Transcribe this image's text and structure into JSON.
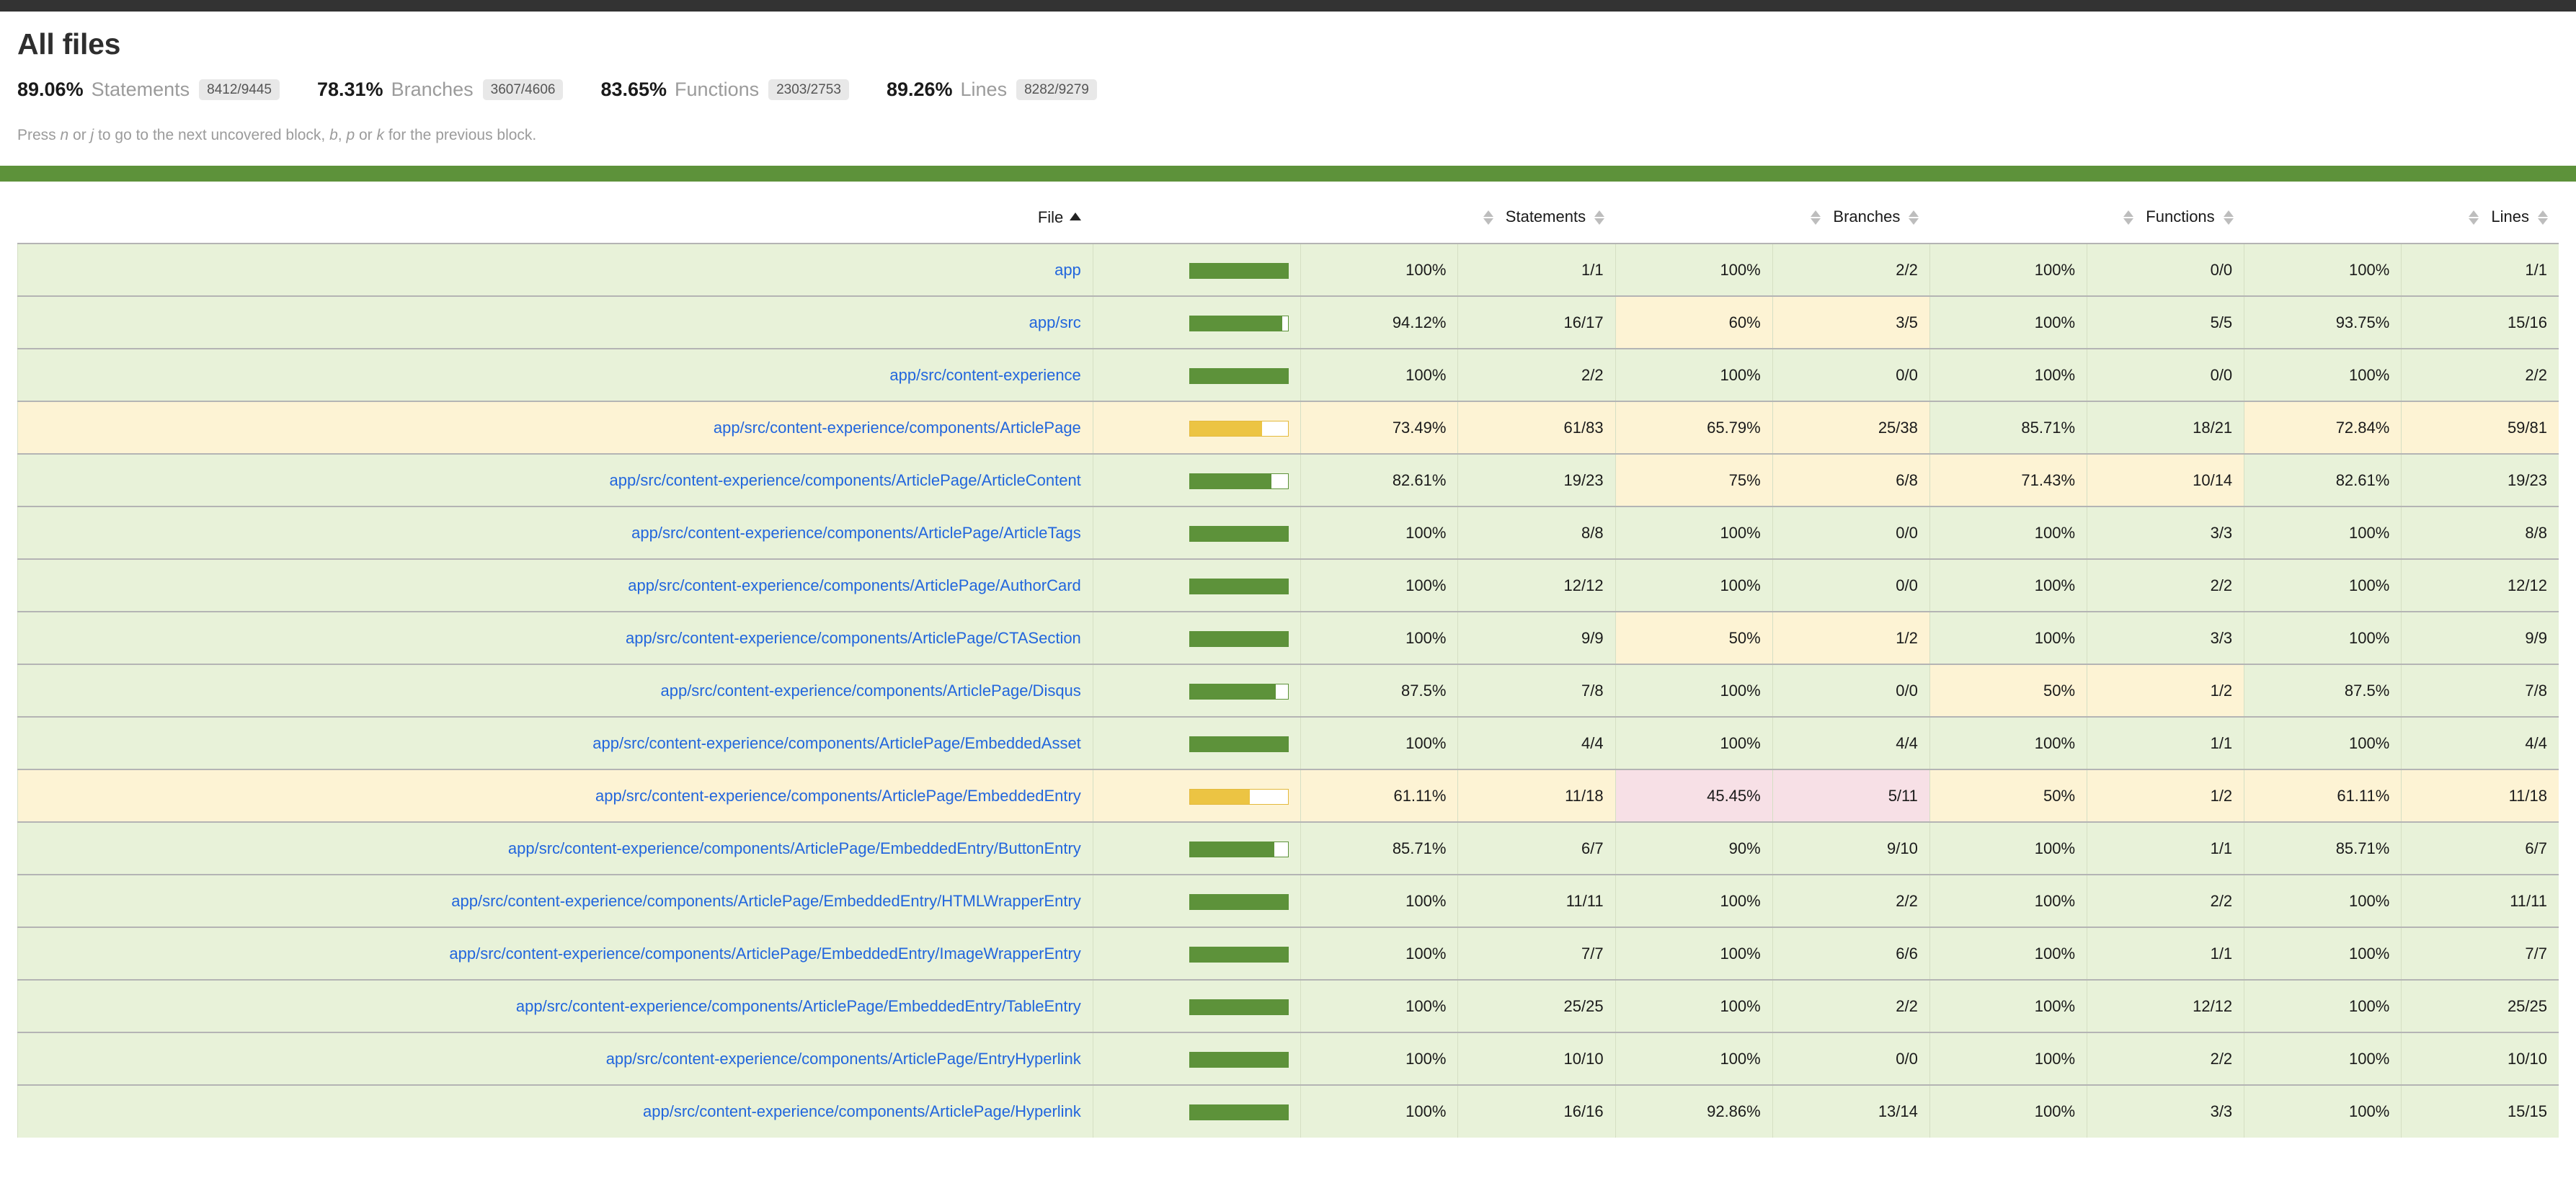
{
  "page": {
    "title": "All files",
    "hint_prefix": "Press ",
    "hint_key_n": "n",
    "hint_or1": " or ",
    "hint_key_j": "j",
    "hint_mid": " to go to the next uncovered block, ",
    "hint_key_b": "b",
    "hint_comma": ", ",
    "hint_key_p": "p",
    "hint_or2": " or ",
    "hint_key_k": "k",
    "hint_suffix": " for the previous block."
  },
  "summary": [
    {
      "pct": "89.06%",
      "label": "Statements",
      "fraction": "8412/9445"
    },
    {
      "pct": "78.31%",
      "label": "Branches",
      "fraction": "3607/4606"
    },
    {
      "pct": "83.65%",
      "label": "Functions",
      "fraction": "2303/2753"
    },
    {
      "pct": "89.26%",
      "label": "Lines",
      "fraction": "8282/9279"
    }
  ],
  "table": {
    "headers": {
      "file": "File",
      "statements": "Statements",
      "branches": "Branches",
      "functions": "Functions",
      "lines": "Lines"
    },
    "sort": {
      "column": "File",
      "direction": "asc"
    },
    "rows": [
      {
        "file": "app",
        "row_state": "high",
        "bar_pct": 100,
        "statements": {
          "pct": "100%",
          "abs": "1/1",
          "state": "high"
        },
        "branches": {
          "pct": "100%",
          "abs": "2/2",
          "state": "high"
        },
        "functions": {
          "pct": "100%",
          "abs": "0/0",
          "state": "high"
        },
        "lines": {
          "pct": "100%",
          "abs": "1/1",
          "state": "high"
        }
      },
      {
        "file": "app/src",
        "row_state": "high",
        "bar_pct": 94.12,
        "statements": {
          "pct": "94.12%",
          "abs": "16/17",
          "state": "high"
        },
        "branches": {
          "pct": "60%",
          "abs": "3/5",
          "state": "medium"
        },
        "functions": {
          "pct": "100%",
          "abs": "5/5",
          "state": "high"
        },
        "lines": {
          "pct": "93.75%",
          "abs": "15/16",
          "state": "high"
        }
      },
      {
        "file": "app/src/content-experience",
        "row_state": "high",
        "bar_pct": 100,
        "statements": {
          "pct": "100%",
          "abs": "2/2",
          "state": "high"
        },
        "branches": {
          "pct": "100%",
          "abs": "0/0",
          "state": "high"
        },
        "functions": {
          "pct": "100%",
          "abs": "0/0",
          "state": "high"
        },
        "lines": {
          "pct": "100%",
          "abs": "2/2",
          "state": "high"
        }
      },
      {
        "file": "app/src/content-experience/components/ArticlePage",
        "row_state": "medium",
        "bar_pct": 73.49,
        "statements": {
          "pct": "73.49%",
          "abs": "61/83",
          "state": "medium"
        },
        "branches": {
          "pct": "65.79%",
          "abs": "25/38",
          "state": "medium"
        },
        "functions": {
          "pct": "85.71%",
          "abs": "18/21",
          "state": "high"
        },
        "lines": {
          "pct": "72.84%",
          "abs": "59/81",
          "state": "medium"
        }
      },
      {
        "file": "app/src/content-experience/components/ArticlePage/ArticleContent",
        "row_state": "high",
        "bar_pct": 82.61,
        "statements": {
          "pct": "82.61%",
          "abs": "19/23",
          "state": "high"
        },
        "branches": {
          "pct": "75%",
          "abs": "6/8",
          "state": "medium"
        },
        "functions": {
          "pct": "71.43%",
          "abs": "10/14",
          "state": "medium"
        },
        "lines": {
          "pct": "82.61%",
          "abs": "19/23",
          "state": "high"
        }
      },
      {
        "file": "app/src/content-experience/components/ArticlePage/ArticleTags",
        "row_state": "high",
        "bar_pct": 100,
        "statements": {
          "pct": "100%",
          "abs": "8/8",
          "state": "high"
        },
        "branches": {
          "pct": "100%",
          "abs": "0/0",
          "state": "high"
        },
        "functions": {
          "pct": "100%",
          "abs": "3/3",
          "state": "high"
        },
        "lines": {
          "pct": "100%",
          "abs": "8/8",
          "state": "high"
        }
      },
      {
        "file": "app/src/content-experience/components/ArticlePage/AuthorCard",
        "row_state": "high",
        "bar_pct": 100,
        "statements": {
          "pct": "100%",
          "abs": "12/12",
          "state": "high"
        },
        "branches": {
          "pct": "100%",
          "abs": "0/0",
          "state": "high"
        },
        "functions": {
          "pct": "100%",
          "abs": "2/2",
          "state": "high"
        },
        "lines": {
          "pct": "100%",
          "abs": "12/12",
          "state": "high"
        }
      },
      {
        "file": "app/src/content-experience/components/ArticlePage/CTASection",
        "row_state": "high",
        "bar_pct": 100,
        "statements": {
          "pct": "100%",
          "abs": "9/9",
          "state": "high"
        },
        "branches": {
          "pct": "50%",
          "abs": "1/2",
          "state": "medium"
        },
        "functions": {
          "pct": "100%",
          "abs": "3/3",
          "state": "high"
        },
        "lines": {
          "pct": "100%",
          "abs": "9/9",
          "state": "high"
        }
      },
      {
        "file": "app/src/content-experience/components/ArticlePage/Disqus",
        "row_state": "high",
        "bar_pct": 87.5,
        "statements": {
          "pct": "87.5%",
          "abs": "7/8",
          "state": "high"
        },
        "branches": {
          "pct": "100%",
          "abs": "0/0",
          "state": "high"
        },
        "functions": {
          "pct": "50%",
          "abs": "1/2",
          "state": "medium"
        },
        "lines": {
          "pct": "87.5%",
          "abs": "7/8",
          "state": "high"
        }
      },
      {
        "file": "app/src/content-experience/components/ArticlePage/EmbeddedAsset",
        "row_state": "high",
        "bar_pct": 100,
        "statements": {
          "pct": "100%",
          "abs": "4/4",
          "state": "high"
        },
        "branches": {
          "pct": "100%",
          "abs": "4/4",
          "state": "high"
        },
        "functions": {
          "pct": "100%",
          "abs": "1/1",
          "state": "high"
        },
        "lines": {
          "pct": "100%",
          "abs": "4/4",
          "state": "high"
        }
      },
      {
        "file": "app/src/content-experience/components/ArticlePage/EmbeddedEntry",
        "row_state": "medium",
        "bar_pct": 61.11,
        "statements": {
          "pct": "61.11%",
          "abs": "11/18",
          "state": "medium"
        },
        "branches": {
          "pct": "45.45%",
          "abs": "5/11",
          "state": "low"
        },
        "functions": {
          "pct": "50%",
          "abs": "1/2",
          "state": "medium"
        },
        "lines": {
          "pct": "61.11%",
          "abs": "11/18",
          "state": "medium"
        }
      },
      {
        "file": "app/src/content-experience/components/ArticlePage/EmbeddedEntry/ButtonEntry",
        "row_state": "high",
        "bar_pct": 85.71,
        "statements": {
          "pct": "85.71%",
          "abs": "6/7",
          "state": "high"
        },
        "branches": {
          "pct": "90%",
          "abs": "9/10",
          "state": "high"
        },
        "functions": {
          "pct": "100%",
          "abs": "1/1",
          "state": "high"
        },
        "lines": {
          "pct": "85.71%",
          "abs": "6/7",
          "state": "high"
        }
      },
      {
        "file": "app/src/content-experience/components/ArticlePage/EmbeddedEntry/HTMLWrapperEntry",
        "row_state": "high",
        "bar_pct": 100,
        "statements": {
          "pct": "100%",
          "abs": "11/11",
          "state": "high"
        },
        "branches": {
          "pct": "100%",
          "abs": "2/2",
          "state": "high"
        },
        "functions": {
          "pct": "100%",
          "abs": "2/2",
          "state": "high"
        },
        "lines": {
          "pct": "100%",
          "abs": "11/11",
          "state": "high"
        }
      },
      {
        "file": "app/src/content-experience/components/ArticlePage/EmbeddedEntry/ImageWrapperEntry",
        "row_state": "high",
        "bar_pct": 100,
        "statements": {
          "pct": "100%",
          "abs": "7/7",
          "state": "high"
        },
        "branches": {
          "pct": "100%",
          "abs": "6/6",
          "state": "high"
        },
        "functions": {
          "pct": "100%",
          "abs": "1/1",
          "state": "high"
        },
        "lines": {
          "pct": "100%",
          "abs": "7/7",
          "state": "high"
        }
      },
      {
        "file": "app/src/content-experience/components/ArticlePage/EmbeddedEntry/TableEntry",
        "row_state": "high",
        "bar_pct": 100,
        "statements": {
          "pct": "100%",
          "abs": "25/25",
          "state": "high"
        },
        "branches": {
          "pct": "100%",
          "abs": "2/2",
          "state": "high"
        },
        "functions": {
          "pct": "100%",
          "abs": "12/12",
          "state": "high"
        },
        "lines": {
          "pct": "100%",
          "abs": "25/25",
          "state": "high"
        }
      },
      {
        "file": "app/src/content-experience/components/ArticlePage/EntryHyperlink",
        "row_state": "high",
        "bar_pct": 100,
        "statements": {
          "pct": "100%",
          "abs": "10/10",
          "state": "high"
        },
        "branches": {
          "pct": "100%",
          "abs": "0/0",
          "state": "high"
        },
        "functions": {
          "pct": "100%",
          "abs": "2/2",
          "state": "high"
        },
        "lines": {
          "pct": "100%",
          "abs": "10/10",
          "state": "high"
        }
      },
      {
        "file": "app/src/content-experience/components/ArticlePage/Hyperlink",
        "row_state": "high",
        "bar_pct": 100,
        "statements": {
          "pct": "100%",
          "abs": "16/16",
          "state": "high"
        },
        "branches": {
          "pct": "92.86%",
          "abs": "13/14",
          "state": "high"
        },
        "functions": {
          "pct": "100%",
          "abs": "3/3",
          "state": "high"
        },
        "lines": {
          "pct": "100%",
          "abs": "15/15",
          "state": "high"
        }
      }
    ]
  }
}
